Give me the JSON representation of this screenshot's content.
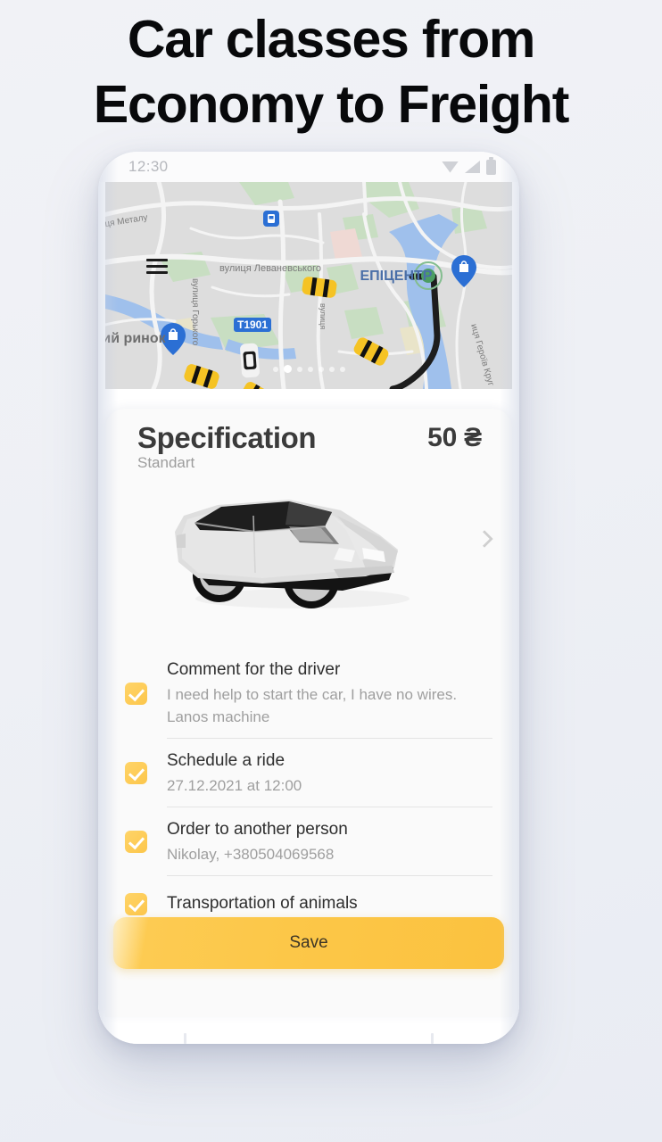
{
  "headline": {
    "line1": "Car classes from",
    "line2": "Economy to Freight"
  },
  "phone": {
    "status_bar": {
      "time": "12:30",
      "icons": [
        "wifi-icon",
        "signal-icon",
        "battery-icon"
      ]
    },
    "map": {
      "menu_icon": "hamburger-menu-icon",
      "street_labels": [
        "ця Металу",
        "вулиця Леваневського",
        "вулиця Горького",
        "вулиця",
        "вулиця Героїв Круг"
      ],
      "place_labels": [
        "ЕПІЦЕНТР",
        "ий ринок"
      ],
      "route_badge": "T1901",
      "poi_icons": [
        "transit-station-icon",
        "shop-pin-icon",
        "shop-pin-icon"
      ],
      "vehicle_icons": [
        "taxi-car-icon",
        "taxi-car-icon",
        "taxi-car-icon",
        "taxi-car-icon",
        "white-car-icon"
      ],
      "pager": {
        "total": 7,
        "active_index": 1
      }
    },
    "sheet": {
      "title": "Specification",
      "subtitle": "Standart",
      "price": "50 ₴",
      "car_preview": {
        "icon": "sedan-car-3d-illustration",
        "next_icon": "chevron-right-icon"
      },
      "options": [
        {
          "checked": true,
          "title": "Comment for the driver",
          "description": "I need help to start the car, I have no wires. Lanos machine"
        },
        {
          "checked": true,
          "title": "Schedule a ride",
          "description": "27.12.2021 at 12:00"
        },
        {
          "checked": true,
          "title": "Order to another person",
          "description": "Nikolay, +380504069568"
        },
        {
          "checked": true,
          "title": "Transportation of animals",
          "description": ""
        }
      ],
      "save_label": "Save"
    }
  },
  "colors": {
    "background": "#f0f1f5",
    "accent_yellow": "#fcc748",
    "checkbox_yellow": "#ffd468",
    "title_text": "#3b3b3b",
    "muted_text": "#9f9f9f",
    "map_base": "#dcdcdc"
  }
}
